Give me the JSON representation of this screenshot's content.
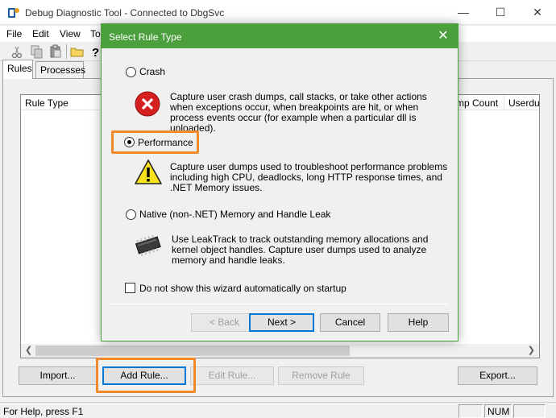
{
  "window": {
    "title": "Debug Diagnostic Tool - Connected to DbgSvc",
    "minimize_glyph": "—",
    "maximize_glyph": "☐",
    "close_glyph": "✕"
  },
  "menu": [
    {
      "label": "File"
    },
    {
      "label": "Edit"
    },
    {
      "label": "View"
    },
    {
      "label": "To"
    }
  ],
  "toolbar": {
    "icons": [
      "cut-icon",
      "copy-icon",
      "paste-icon",
      "folder-icon",
      "help-icon"
    ]
  },
  "tabs": [
    {
      "label": "Rules",
      "active": true
    },
    {
      "label": "Processes",
      "active": false
    }
  ],
  "rules_list": {
    "columns": [
      "Rule Type",
      "mp Count",
      "Userdu"
    ],
    "rows": []
  },
  "buttons": {
    "import": "Import...",
    "add_rule": "Add Rule...",
    "edit_rule": "Edit Rule...",
    "remove_rule": "Remove Rule",
    "export": "Export..."
  },
  "status": {
    "text": "For Help, press F1",
    "num": "NUM"
  },
  "dialog": {
    "title": "Select Rule Type",
    "close_glyph": "✕",
    "options": [
      {
        "label": "Crash",
        "selected": false,
        "icon": "error-icon",
        "description": "Capture user crash dumps, call stacks, or take other actions when exceptions occur, when breakpoints are hit, or when process events occur (for example when a particular dll is unloaded)."
      },
      {
        "label": "Performance",
        "selected": true,
        "icon": "warning-icon",
        "description": "Capture user dumps used to troubleshoot performance problems including high CPU, deadlocks, long HTTP response times, and .NET Memory issues."
      },
      {
        "label": "Native (non-.NET) Memory and Handle Leak",
        "selected": false,
        "icon": "memory-chip-icon",
        "description": "Use LeakTrack to track outstanding memory allocations and kernel object handles. Capture user dumps used to analyze memory and handle leaks."
      }
    ],
    "checkbox_label": "Do not show this wizard automatically on startup",
    "checkbox_checked": false,
    "buttons": {
      "back": "< Back",
      "next": "Next >",
      "cancel": "Cancel",
      "help": "Help"
    }
  },
  "colors": {
    "dialog_title_bg": "#4b9f3c",
    "highlight": "#f08a2c"
  }
}
